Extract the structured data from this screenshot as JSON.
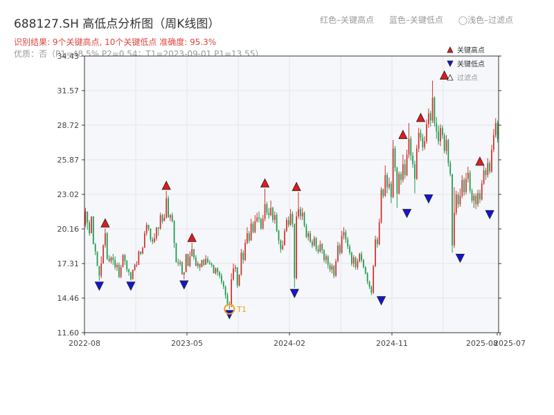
{
  "header": {
    "title": "688127.SH 高低点分析图（周K线图）",
    "top_legend": [
      "红色–关键高点",
      "蓝色–关键低点",
      "◯浅色–过滤点"
    ],
    "result_line": "识别结果: 9个关键高点, 10个关键低点  准确度: 95.3%",
    "quality_line": "优质：否（P1=48.5%  P2=0.54；T1=2023-09-01 P1=13.55）"
  },
  "colors": {
    "up": "#d0312d",
    "down": "#1e9a4a",
    "high_marker": "#e01b1b",
    "low_marker": "#1515d0",
    "t1_marker": "#f0a020",
    "plot_bg": "#f5f7fa",
    "grid": "#e3e6ea"
  },
  "chart_data": {
    "type": "candlestick",
    "title": "688127.SH 高低点分析图（周K线图）",
    "x_ticks": [
      "2022-08",
      "2023-05",
      "2024-02",
      "2024-11",
      "2025-07",
      "2025-08"
    ],
    "y_ticks": [
      "11.60",
      "14.46",
      "17.31",
      "20.16",
      "23.02",
      "25.87",
      "28.72",
      "31.57",
      "34.43"
    ],
    "ylim": [
      11.6,
      34.43
    ],
    "grid": true,
    "legend_position": "top-right",
    "legend": [
      {
        "label": "关键高点",
        "kind": "high"
      },
      {
        "label": "关键低点",
        "kind": "low"
      },
      {
        "label": "过滤点",
        "kind": "filtered"
      }
    ],
    "annotation": "T1",
    "key_highs": [
      {
        "week": 10,
        "price": 20.2
      },
      {
        "week": 41,
        "price": 23.3
      },
      {
        "week": 54,
        "price": 19.0
      },
      {
        "week": 91,
        "price": 23.5
      },
      {
        "week": 107,
        "price": 23.2
      },
      {
        "week": 161,
        "price": 27.5
      },
      {
        "week": 170,
        "price": 28.9
      },
      {
        "week": 182,
        "price": 32.4
      },
      {
        "week": 200,
        "price": 25.3
      }
    ],
    "key_lows": [
      {
        "week": 7,
        "price": 15.9
      },
      {
        "week": 23,
        "price": 15.9
      },
      {
        "week": 50,
        "price": 16.0
      },
      {
        "week": 73,
        "price": 13.55
      },
      {
        "week": 106,
        "price": 15.3
      },
      {
        "week": 150,
        "price": 14.7
      },
      {
        "week": 163,
        "price": 21.9
      },
      {
        "week": 174,
        "price": 23.1
      },
      {
        "week": 190,
        "price": 18.2
      },
      {
        "week": 205,
        "price": 21.8
      }
    ],
    "t1_point": {
      "week": 73,
      "price": 13.55
    },
    "candles_note": "Weekly OHLC bars approximated from the picture.",
    "candles": [
      [
        20.5,
        21.6,
        21.9,
        20.3
      ],
      [
        21.6,
        20.7,
        21.6,
        20.1
      ],
      [
        20.7,
        19.8,
        20.9,
        19.6
      ],
      [
        19.8,
        21.2,
        21.2,
        19.8
      ],
      [
        21.2,
        18.9,
        21.2,
        18.9
      ],
      [
        18.9,
        18.3,
        19.0,
        18.0
      ],
      [
        18.3,
        17.1,
        18.3,
        17.1
      ],
      [
        17.1,
        16.3,
        17.1,
        15.9
      ],
      [
        16.3,
        17.3,
        17.9,
        16.1
      ],
      [
        17.3,
        18.8,
        18.9,
        17.3
      ],
      [
        18.8,
        19.8,
        20.2,
        18.6
      ],
      [
        19.8,
        17.7,
        19.9,
        17.6
      ],
      [
        17.7,
        17.5,
        18.0,
        17.4
      ],
      [
        17.5,
        17.8,
        17.9,
        17.3
      ],
      [
        17.8,
        17.6,
        18.1,
        17.2
      ],
      [
        17.6,
        17.0,
        17.9,
        16.8
      ],
      [
        17.0,
        17.2,
        17.4,
        16.7
      ],
      [
        17.2,
        16.2,
        17.4,
        16.1
      ],
      [
        16.2,
        17.0,
        17.2,
        16.1
      ],
      [
        17.0,
        18.0,
        18.1,
        17.0
      ],
      [
        18.0,
        17.5,
        18.1,
        17.2
      ],
      [
        17.5,
        16.8,
        17.6,
        16.6
      ],
      [
        16.8,
        16.6,
        16.9,
        16.3
      ],
      [
        16.6,
        16.0,
        16.6,
        15.9
      ],
      [
        16.0,
        16.8,
        16.8,
        16.0
      ],
      [
        16.8,
        17.2,
        17.3,
        16.7
      ],
      [
        17.2,
        17.2,
        17.5,
        17.0
      ],
      [
        17.2,
        18.3,
        18.4,
        17.2
      ],
      [
        18.3,
        18.1,
        18.3,
        18.0
      ],
      [
        18.1,
        18.6,
        18.7,
        18.1
      ],
      [
        18.6,
        19.8,
        20.0,
        18.6
      ],
      [
        19.8,
        20.5,
        20.7,
        19.6
      ],
      [
        20.5,
        20.2,
        20.5,
        20.0
      ],
      [
        20.2,
        19.3,
        20.2,
        19.1
      ],
      [
        19.3,
        19.1,
        19.5,
        18.9
      ],
      [
        19.1,
        19.4,
        19.8,
        19.0
      ],
      [
        19.4,
        20.3,
        20.3,
        19.2
      ],
      [
        20.3,
        20.2,
        20.3,
        19.6
      ],
      [
        20.2,
        21.3,
        21.5,
        20.1
      ],
      [
        21.3,
        20.8,
        21.4,
        20.6
      ],
      [
        20.8,
        21.1,
        21.4,
        20.8
      ],
      [
        21.1,
        22.7,
        23.3,
        21.0
      ],
      [
        22.7,
        21.1,
        22.9,
        21.1
      ],
      [
        21.1,
        21.3,
        21.4,
        20.8
      ],
      [
        21.3,
        20.8,
        21.5,
        20.7
      ],
      [
        20.8,
        19.0,
        20.9,
        18.6
      ],
      [
        19.0,
        17.4,
        19.0,
        17.4
      ],
      [
        17.4,
        17.3,
        17.7,
        17.1
      ],
      [
        17.3,
        17.4,
        17.6,
        17.1
      ],
      [
        17.4,
        16.4,
        17.5,
        16.4
      ],
      [
        16.4,
        16.6,
        16.6,
        16.0
      ],
      [
        16.6,
        18.1,
        18.1,
        16.6
      ],
      [
        18.1,
        17.1,
        18.1,
        17.1
      ],
      [
        17.1,
        17.9,
        18.3,
        17.0
      ],
      [
        17.9,
        18.5,
        19.0,
        17.9
      ],
      [
        18.5,
        17.8,
        18.5,
        17.6
      ],
      [
        17.8,
        17.1,
        18.0,
        17.1
      ],
      [
        17.1,
        17.3,
        17.5,
        16.9
      ],
      [
        17.3,
        17.0,
        17.3,
        16.7
      ],
      [
        17.0,
        17.6,
        17.6,
        17.0
      ],
      [
        17.6,
        17.2,
        17.7,
        17.1
      ],
      [
        17.2,
        17.7,
        18.0,
        17.2
      ],
      [
        17.7,
        17.4,
        17.9,
        17.3
      ],
      [
        17.4,
        17.3,
        17.6,
        17.2
      ],
      [
        17.3,
        17.2,
        17.4,
        17.0
      ],
      [
        17.2,
        16.5,
        17.2,
        16.5
      ],
      [
        16.5,
        16.9,
        17.0,
        16.4
      ],
      [
        16.9,
        16.6,
        17.0,
        16.3
      ],
      [
        16.6,
        16.3,
        16.7,
        16.1
      ],
      [
        16.3,
        15.8,
        16.5,
        15.6
      ],
      [
        15.8,
        15.4,
        15.9,
        15.2
      ],
      [
        15.4,
        14.7,
        15.5,
        14.4
      ],
      [
        14.7,
        14.0,
        14.9,
        13.8
      ],
      [
        14.0,
        13.9,
        14.2,
        13.55
      ],
      [
        13.9,
        16.0,
        16.5,
        13.7
      ],
      [
        16.0,
        16.9,
        17.3,
        15.9
      ],
      [
        16.9,
        17.0,
        17.2,
        16.6
      ],
      [
        17.0,
        15.5,
        17.0,
        15.3
      ],
      [
        15.5,
        16.4,
        16.4,
        15.4
      ],
      [
        16.4,
        18.2,
        18.5,
        16.3
      ],
      [
        18.2,
        17.6,
        18.4,
        17.3
      ],
      [
        17.6,
        19.0,
        19.3,
        17.5
      ],
      [
        19.0,
        19.8,
        20.3,
        18.9
      ],
      [
        19.8,
        19.2,
        20.0,
        19.0
      ],
      [
        19.2,
        20.6,
        21.0,
        19.2
      ],
      [
        20.6,
        19.9,
        20.8,
        19.8
      ],
      [
        19.9,
        20.8,
        21.3,
        19.8
      ],
      [
        20.8,
        21.1,
        21.5,
        20.7
      ],
      [
        21.1,
        21.0,
        21.6,
        20.7
      ],
      [
        21.0,
        20.2,
        21.1,
        20.1
      ],
      [
        20.2,
        21.0,
        21.3,
        20.1
      ],
      [
        21.0,
        22.2,
        23.5,
        20.8
      ],
      [
        22.2,
        21.5,
        22.4,
        21.3
      ],
      [
        21.5,
        21.3,
        21.9,
        21.0
      ],
      [
        21.3,
        21.9,
        22.5,
        21.2
      ],
      [
        21.9,
        20.9,
        22.0,
        20.7
      ],
      [
        20.9,
        21.3,
        21.6,
        20.6
      ],
      [
        21.3,
        20.0,
        21.5,
        19.9
      ],
      [
        20.0,
        19.2,
        20.1,
        18.9
      ],
      [
        19.2,
        18.5,
        19.3,
        18.2
      ],
      [
        18.5,
        18.8,
        19.2,
        18.4
      ],
      [
        18.8,
        20.0,
        20.2,
        18.8
      ],
      [
        20.0,
        20.9,
        21.1,
        19.9
      ],
      [
        20.9,
        20.5,
        21.2,
        20.3
      ],
      [
        20.5,
        21.4,
        21.8,
        20.4
      ],
      [
        21.4,
        20.6,
        21.6,
        20.3
      ],
      [
        20.6,
        16.1,
        20.6,
        15.3
      ],
      [
        16.1,
        21.2,
        21.6,
        16.0
      ],
      [
        21.2,
        21.8,
        23.2,
        21.0
      ],
      [
        21.8,
        21.2,
        22.0,
        20.9
      ],
      [
        21.2,
        21.5,
        21.9,
        20.9
      ],
      [
        21.5,
        20.4,
        21.6,
        20.3
      ],
      [
        20.4,
        19.5,
        20.6,
        19.4
      ],
      [
        19.5,
        19.8,
        20.0,
        19.2
      ],
      [
        19.8,
        19.1,
        20.0,
        19.0
      ],
      [
        19.1,
        18.8,
        19.3,
        18.6
      ],
      [
        18.8,
        19.4,
        19.6,
        18.7
      ],
      [
        19.4,
        18.5,
        19.5,
        18.3
      ],
      [
        18.5,
        18.3,
        18.8,
        18.1
      ],
      [
        18.3,
        18.9,
        19.2,
        18.2
      ],
      [
        18.9,
        18.4,
        19.0,
        18.1
      ],
      [
        18.4,
        17.6,
        18.5,
        17.4
      ],
      [
        17.6,
        17.9,
        18.1,
        17.3
      ],
      [
        17.9,
        17.2,
        18.0,
        16.9
      ],
      [
        17.2,
        16.8,
        17.4,
        16.6
      ],
      [
        16.8,
        17.1,
        17.3,
        16.5
      ],
      [
        17.1,
        16.3,
        17.2,
        16.1
      ],
      [
        16.3,
        17.5,
        17.7,
        16.2
      ],
      [
        17.5,
        18.8,
        19.1,
        17.4
      ],
      [
        18.8,
        18.2,
        19.0,
        18.0
      ],
      [
        18.2,
        19.6,
        20.0,
        18.1
      ],
      [
        19.6,
        19.9,
        20.3,
        19.3
      ],
      [
        19.9,
        19.3,
        20.1,
        19.0
      ],
      [
        19.3,
        18.7,
        19.5,
        18.5
      ],
      [
        18.7,
        18.2,
        18.9,
        18.0
      ],
      [
        18.2,
        17.3,
        18.3,
        17.1
      ],
      [
        17.3,
        17.8,
        18.0,
        17.0
      ],
      [
        17.8,
        17.0,
        17.9,
        16.8
      ],
      [
        17.0,
        17.5,
        17.7,
        16.8
      ],
      [
        17.5,
        18.1,
        18.2,
        17.4
      ],
      [
        18.1,
        17.6,
        18.3,
        17.4
      ],
      [
        17.6,
        17.0,
        17.7,
        16.9
      ],
      [
        17.0,
        16.5,
        17.1,
        16.4
      ],
      [
        16.5,
        15.8,
        16.6,
        15.6
      ],
      [
        15.8,
        15.4,
        15.9,
        15.2
      ],
      [
        15.4,
        14.9,
        15.5,
        14.7
      ],
      [
        14.9,
        17.1,
        17.2,
        14.8
      ],
      [
        17.1,
        19.3,
        19.6,
        17.0
      ],
      [
        19.3,
        18.9,
        19.5,
        18.6
      ],
      [
        18.9,
        20.7,
        21.0,
        18.8
      ],
      [
        20.7,
        23.4,
        23.6,
        20.6
      ],
      [
        23.4,
        22.9,
        23.5,
        22.7
      ],
      [
        22.9,
        24.6,
        25.4,
        22.8
      ],
      [
        24.6,
        23.6,
        24.8,
        23.1
      ],
      [
        23.6,
        23.9,
        24.4,
        23.4
      ],
      [
        23.9,
        22.8,
        24.1,
        22.3
      ],
      [
        22.8,
        26.8,
        27.5,
        22.7
      ],
      [
        26.8,
        25.2,
        27.0,
        24.9
      ],
      [
        25.2,
        23.1,
        25.3,
        21.9
      ],
      [
        23.1,
        24.7,
        24.9,
        23.0
      ],
      [
        24.7,
        24.2,
        24.9,
        23.8
      ],
      [
        24.2,
        25.5,
        26.3,
        24.0
      ],
      [
        25.5,
        24.6,
        25.9,
        24.3
      ],
      [
        24.6,
        26.3,
        26.7,
        24.5
      ],
      [
        26.3,
        27.6,
        28.9,
        26.0
      ],
      [
        27.6,
        26.2,
        27.8,
        25.8
      ],
      [
        26.2,
        25.5,
        26.5,
        25.2
      ],
      [
        25.5,
        24.3,
        25.8,
        23.1
      ],
      [
        24.3,
        26.8,
        27.1,
        24.2
      ],
      [
        26.8,
        28.1,
        28.5,
        26.5
      ],
      [
        28.1,
        27.7,
        28.4,
        27.4
      ],
      [
        27.7,
        26.9,
        28.0,
        26.6
      ],
      [
        26.9,
        27.4,
        27.8,
        26.7
      ],
      [
        27.4,
        28.8,
        29.2,
        27.2
      ],
      [
        28.8,
        29.7,
        30.1,
        28.5
      ],
      [
        29.7,
        29.1,
        29.9,
        28.6
      ],
      [
        29.1,
        31.0,
        32.4,
        28.9
      ],
      [
        31.0,
        28.9,
        31.1,
        28.6
      ],
      [
        28.9,
        28.2,
        29.4,
        27.6
      ],
      [
        28.2,
        27.4,
        28.7,
        27.1
      ],
      [
        27.4,
        28.5,
        28.8,
        27.0
      ],
      [
        28.5,
        27.9,
        28.7,
        27.6
      ],
      [
        27.9,
        26.6,
        28.1,
        26.4
      ],
      [
        26.6,
        27.5,
        27.9,
        26.3
      ],
      [
        27.5,
        25.6,
        27.6,
        25.3
      ],
      [
        25.6,
        24.7,
        25.8,
        24.5
      ],
      [
        24.7,
        18.8,
        24.7,
        18.2
      ],
      [
        18.8,
        21.5,
        23.6,
        18.6
      ],
      [
        21.5,
        23.0,
        23.3,
        21.3
      ],
      [
        23.0,
        22.2,
        23.2,
        21.9
      ],
      [
        22.2,
        22.9,
        23.5,
        22.0
      ],
      [
        22.9,
        24.2,
        24.6,
        22.7
      ],
      [
        24.2,
        23.2,
        24.4,
        22.9
      ],
      [
        23.2,
        24.3,
        24.8,
        23.0
      ],
      [
        24.3,
        24.8,
        25.3,
        24.0
      ],
      [
        24.8,
        23.3,
        25.0,
        23.1
      ],
      [
        23.3,
        22.5,
        23.5,
        22.3
      ],
      [
        22.5,
        22.9,
        23.1,
        21.9
      ],
      [
        22.9,
        22.2,
        23.1,
        21.8
      ],
      [
        22.2,
        23.1,
        23.4,
        22.0
      ],
      [
        23.1,
        22.6,
        23.4,
        22.3
      ],
      [
        22.6,
        23.9,
        24.2,
        22.5
      ],
      [
        23.9,
        25.0,
        25.4,
        23.8
      ],
      [
        25.0,
        24.6,
        25.2,
        24.2
      ],
      [
        24.6,
        25.6,
        26.0,
        24.4
      ],
      [
        25.6,
        24.9,
        25.8,
        24.7
      ],
      [
        24.9,
        26.7,
        27.1,
        24.8
      ],
      [
        26.7,
        27.9,
        28.4,
        26.5
      ],
      [
        27.9,
        28.9,
        29.3,
        27.7
      ],
      [
        28.9,
        27.6,
        29.1,
        27.3
      ]
    ]
  }
}
